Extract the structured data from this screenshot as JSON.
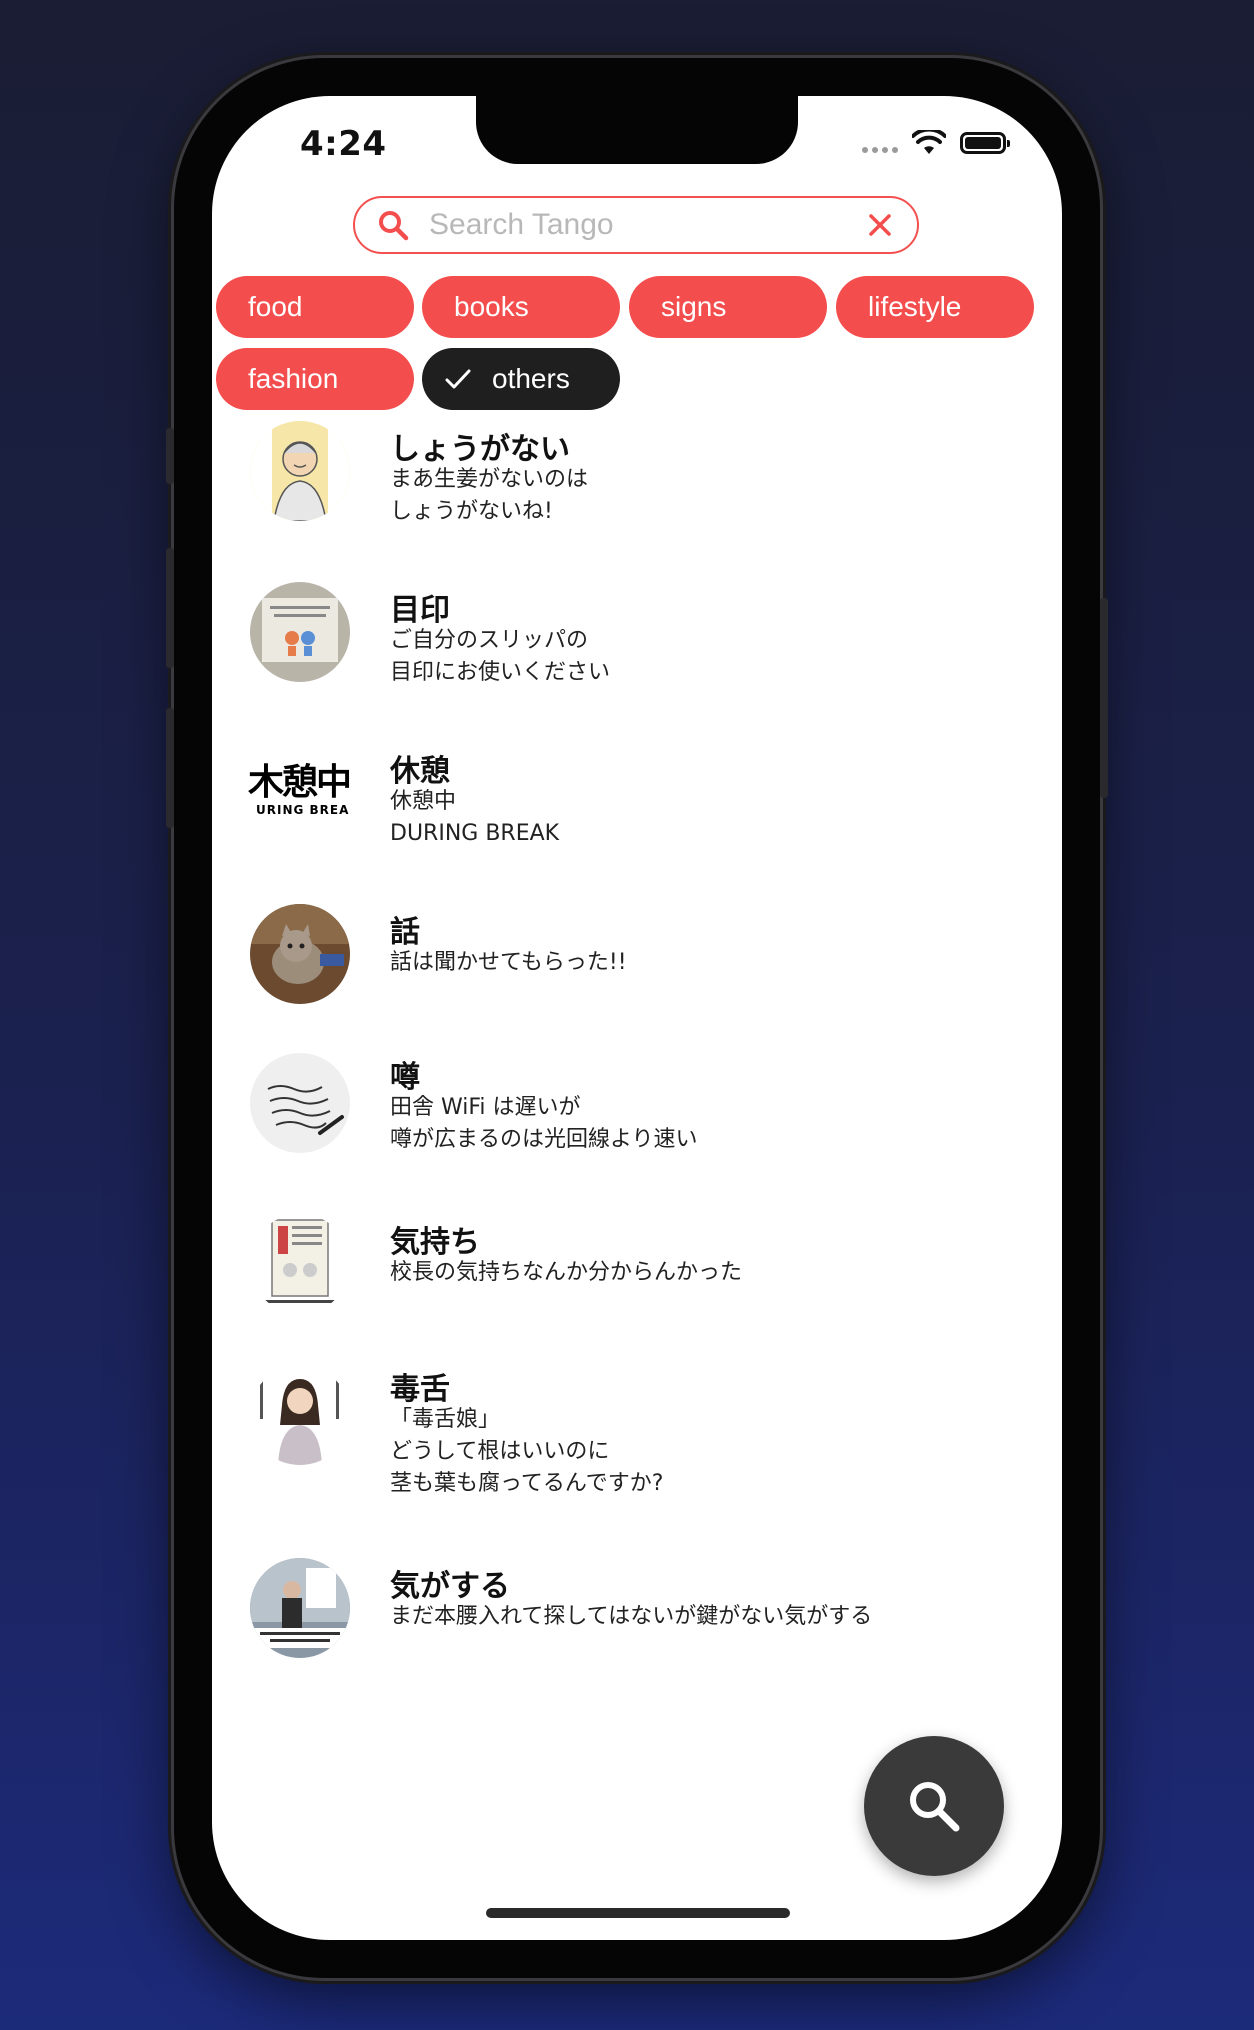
{
  "status_bar": {
    "time": "4:24"
  },
  "search": {
    "placeholder": "Search Tango",
    "value": ""
  },
  "chips": [
    {
      "label": "food",
      "selected": false
    },
    {
      "label": "books",
      "selected": false
    },
    {
      "label": "signs",
      "selected": false
    },
    {
      "label": "lifestyle",
      "selected": false
    },
    {
      "label": "fashion",
      "selected": false
    },
    {
      "label": "others",
      "selected": true
    }
  ],
  "words": [
    {
      "title": "しょうがない",
      "lines": [
        "まあ生姜がないのは",
        "しょうがないね!"
      ]
    },
    {
      "title": "目印",
      "lines": [
        "ご自分のスリッパの",
        "目印にお使いください"
      ]
    },
    {
      "title": "休憩",
      "lines": [
        "休憩中",
        "DURING BREAK"
      ]
    },
    {
      "title": "話",
      "lines": [
        "話は聞かせてもらった!!"
      ]
    },
    {
      "title": "噂",
      "lines": [
        "田舎 WiFi は遅いが",
        "噂が広まるのは光回線より速い"
      ]
    },
    {
      "title": "気持ち",
      "lines": [
        "校長の気持ちなんか分からんかった"
      ]
    },
    {
      "title": "毒舌",
      "lines": [
        "「毒舌娘」",
        "どうして根はいいのに",
        "茎も葉も腐ってるんですか?"
      ]
    },
    {
      "title": "気がする",
      "lines": [
        "まだ本腰入れて探してはないが鍵がない気がする"
      ]
    }
  ],
  "thumb_texts": {
    "break_sign_main": "木憩中",
    "break_sign_sub": "URING BREA"
  },
  "colors": {
    "accent": "#f44d4d",
    "selected_chip": "#1f1f1f",
    "fab": "#3a3a3a"
  }
}
